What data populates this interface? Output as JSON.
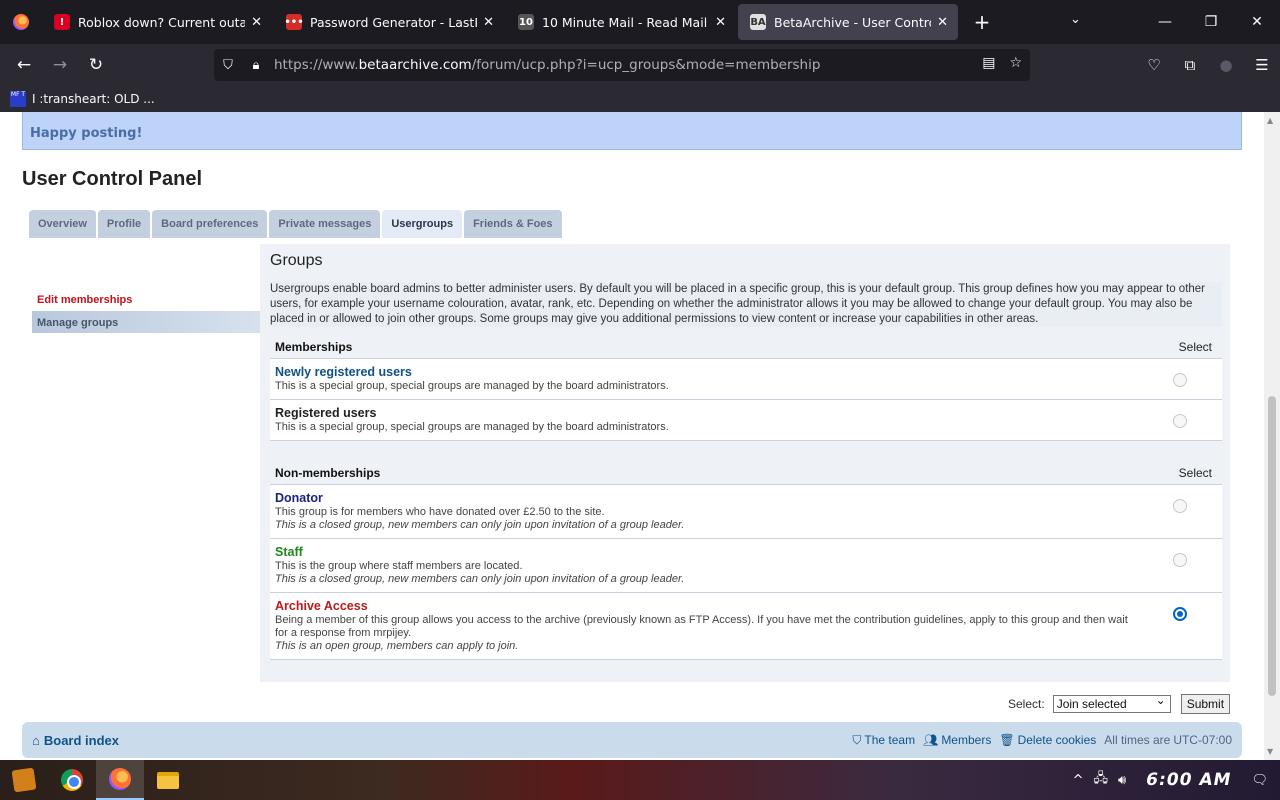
{
  "browser": {
    "tabs": [
      {
        "title": "Roblox down? Current outages",
        "icon_color": "#d70022",
        "icon_glyph": "!"
      },
      {
        "title": "Password Generator - LastPass",
        "icon_color": "#d32d27",
        "icon_glyph": "•••"
      },
      {
        "title": "10 Minute Mail - Read Mail",
        "icon_color": "#555555",
        "icon_glyph": "10"
      },
      {
        "title": "BetaArchive - User Control Panel",
        "icon_color": "#e0e0e0",
        "icon_glyph": "BA"
      }
    ],
    "url_prefix": "https://www.",
    "url_domain": "betaarchive.com",
    "url_path": "/forum/ucp.php?i=ucp_groups&mode=membership",
    "bookmark": {
      "label": "I :transheart: OLD ...",
      "icon_text": "MF T"
    }
  },
  "page": {
    "notice": "Happy posting!",
    "title": "User Control Panel",
    "tabs": [
      "Overview",
      "Profile",
      "Board preferences",
      "Private messages",
      "Usergroups",
      "Friends & Foes"
    ],
    "active_tab": "Usergroups",
    "sidebar": {
      "current": "Edit memberships",
      "other": "Manage groups"
    },
    "section_title": "Groups",
    "intro": "Usergroups enable board admins to better administer users. By default you will be placed in a specific group, this is your default group. This group defines how you may appear to other users, for example your username colouration, avatar, rank, etc. Depending on whether the administrator allows it you may be allowed to change your default group. You may also be placed in or allowed to join other groups. Some groups may give you additional permissions to view content or increase your capabilities in other areas.",
    "memberships": {
      "header": "Memberships",
      "select_label": "Select",
      "groups": [
        {
          "name": "Newly registered users",
          "color": "#105289",
          "desc": "This is a special group, special groups are managed by the board administrators.",
          "status": "",
          "selected": false
        },
        {
          "name": "Registered users",
          "color": "#222222",
          "desc": "This is a special group, special groups are managed by the board administrators.",
          "status": "",
          "selected": false
        }
      ]
    },
    "non_memberships": {
      "header": "Non-memberships",
      "select_label": "Select",
      "groups": [
        {
          "name": "Donator",
          "color": "#1a237e",
          "desc": "This group is for members who have donated over £2.50 to the site.",
          "status": "This is a closed group, new members can only join upon invitation of a group leader.",
          "selected": false
        },
        {
          "name": "Staff",
          "color": "#1b8a1b",
          "desc": "This is the group where staff members are located.",
          "status": "This is a closed group, new members can only join upon invitation of a group leader.",
          "selected": false
        },
        {
          "name": "Archive Access",
          "color": "#b71c1c",
          "desc": "Being a member of this group allows you access to the archive (previously known as FTP Access). If you have met the contribution guidelines, apply to this group and then wait for a response from mrpijey.",
          "status": "This is an open group, members can apply to join.",
          "selected": true
        }
      ]
    },
    "action": {
      "label": "Select:",
      "selected_option": "Join selected",
      "submit": "Submit"
    },
    "footer": {
      "board_index": "Board index",
      "team": "The team",
      "members": "Members",
      "delete_cookies": "Delete cookies",
      "timezone_prefix": "All times are",
      "timezone": "UTC-07:00"
    }
  },
  "taskbar": {
    "clock": "6:00 AM"
  }
}
